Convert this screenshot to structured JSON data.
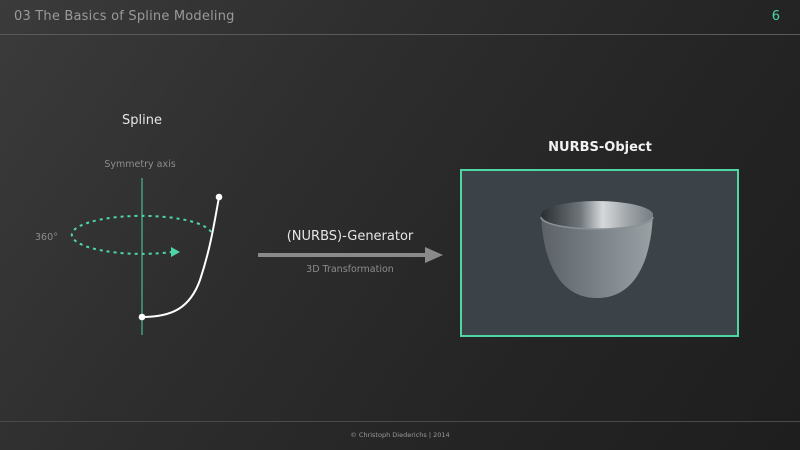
{
  "header": {
    "title": "03 The Basics of Spline Modeling",
    "page_number": "6"
  },
  "left_diagram": {
    "title": "Spline",
    "axis_label": "Symmetry axis",
    "angle_label": "360°"
  },
  "middle": {
    "generator_label": "(NURBS)-Generator",
    "transform_label": "3D Transformation"
  },
  "right": {
    "title": "NURBS-Object"
  },
  "footer": {
    "text": "© Christoph Diederichs | 2014"
  },
  "colors": {
    "accent": "#4fd6a6",
    "background": "#2a2a2a",
    "arrow": "#8a8a8a",
    "render_bg": "#3c4348"
  }
}
